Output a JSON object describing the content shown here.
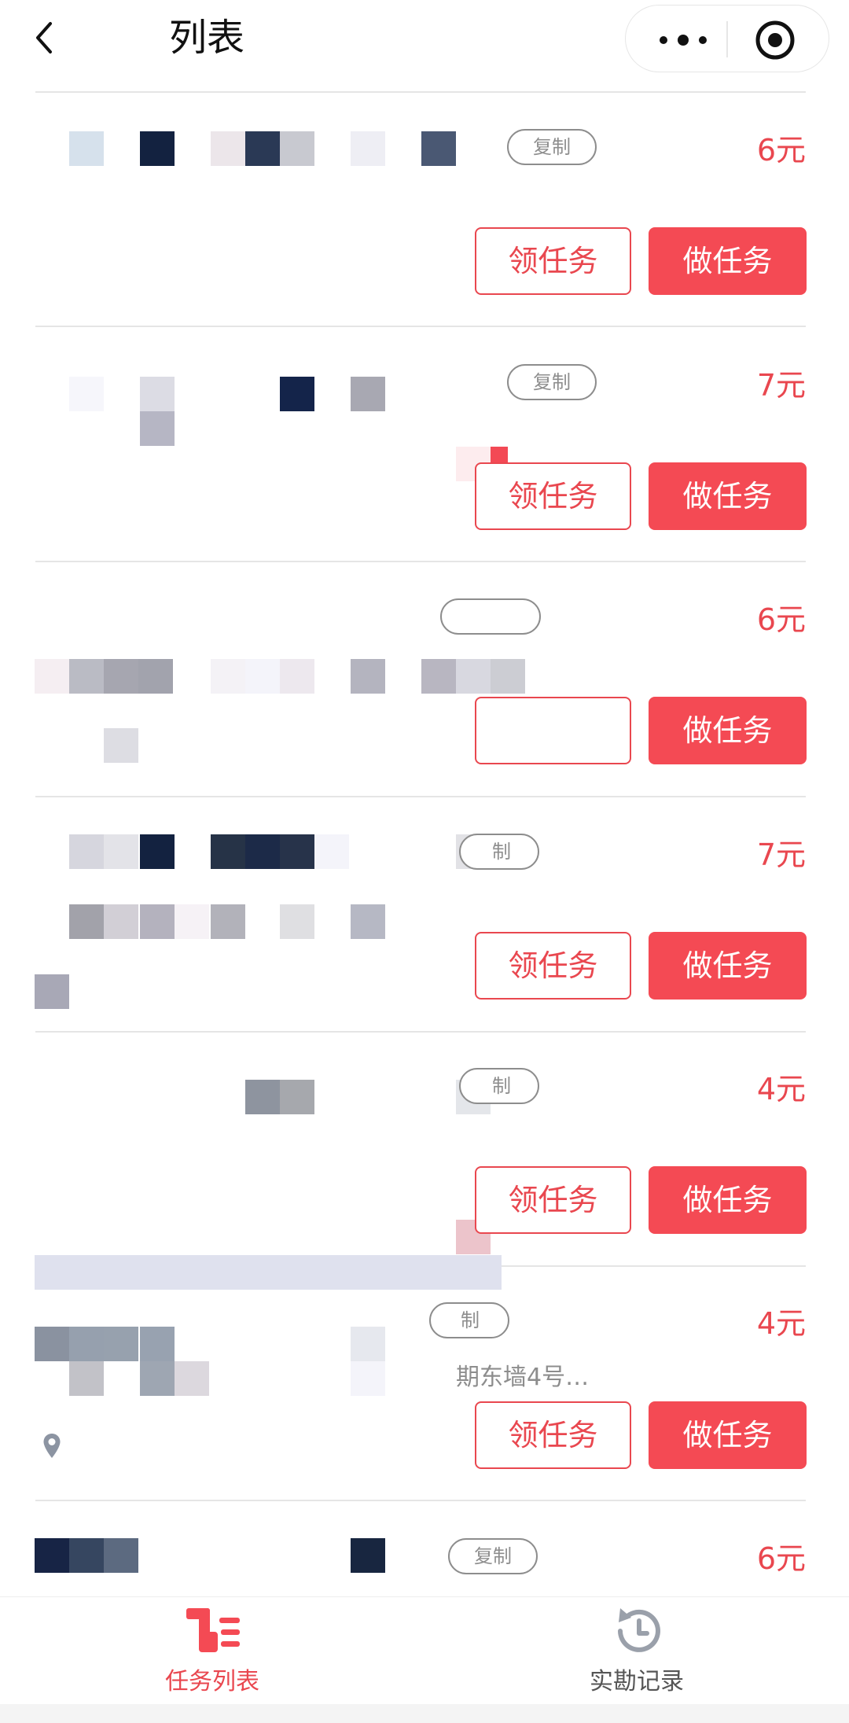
{
  "header": {
    "title": "列表",
    "back_icon": "chevron-left-icon",
    "more_icon": "more-dots-icon",
    "capsule_icon": "target-circle-icon"
  },
  "tasks": [
    {
      "copy_label": "复制",
      "price": "6元",
      "claim_label": "领任务",
      "do_label": "做任务"
    },
    {
      "copy_label": "复制",
      "price": "7元",
      "claim_label": "领任务",
      "do_label": "做任务"
    },
    {
      "copy_label": "",
      "price": "6元",
      "claim_label": "",
      "do_label": "做任务"
    },
    {
      "copy_label": "制",
      "price": "7元",
      "claim_label": "领任务",
      "do_label": "做任务"
    },
    {
      "copy_label": "制",
      "price": "4元",
      "claim_label": "领任务",
      "do_label": "做任务"
    },
    {
      "copy_label": "制",
      "price": "4元",
      "address": "期东墙4号…",
      "claim_label": "领任务",
      "do_label": "做任务"
    },
    {
      "copy_label": "复制",
      "price": "6元"
    }
  ],
  "tabbar": {
    "items": [
      {
        "label": "任务列表",
        "icon": "task-list-icon",
        "active": true
      },
      {
        "label": "实勘记录",
        "icon": "history-clock-icon",
        "active": false
      }
    ]
  },
  "colors": {
    "accent": "#f44a54",
    "accent_text": "#e9474f",
    "muted": "#8d8d8d",
    "active_tab": "#e9474f",
    "inactive_tab": "#555555"
  }
}
